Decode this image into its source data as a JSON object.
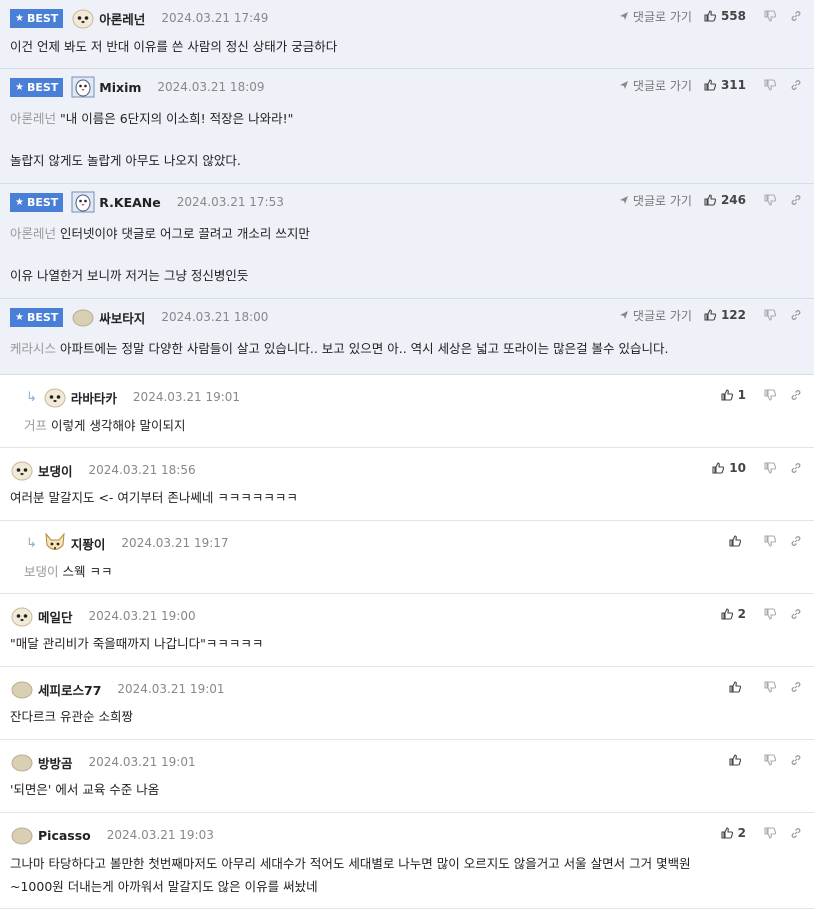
{
  "actions": {
    "goto_label": "댓글로 가기"
  },
  "badge_label": "BEST",
  "comments": [
    {
      "nick": "아론레넌",
      "date": "2024.03.21 17:49",
      "likes": "558",
      "best": true,
      "lines": [
        "이건 언제 봐도 저 반대 이유를 쓴 사람의 정신 상태가 궁금하다"
      ]
    },
    {
      "nick": "Mixim",
      "date": "2024.03.21 18:09",
      "likes": "311",
      "best": true,
      "mention": "아론레넌",
      "lines": [
        "\"내 이름은 6단지의 이소희! 적장은 나와라!\"",
        "",
        "놀랍지 않게도 놀랍게 아무도 나오지 않았다."
      ]
    },
    {
      "nick": "R.KEANe",
      "date": "2024.03.21 17:53",
      "likes": "246",
      "best": true,
      "mention": "아론레넌",
      "lines": [
        "인터넷이야 댓글로 어그로 끌려고 개소리 쓰지만",
        "",
        "이유 나열한거 보니까 저거는 그냥 정신병인듯"
      ]
    },
    {
      "nick": "싸보타지",
      "date": "2024.03.21 18:00",
      "likes": "122",
      "best": true,
      "mention": "케라시스",
      "lines": [
        "아파트에는 정말 다양한 사람들이 살고 있습니다.. 보고 있으면 아.. 역시 세상은 넓고 또라이는 많은걸 볼수 있습니다."
      ]
    },
    {
      "nick": "라바타카",
      "date": "2024.03.21 19:01",
      "likes": "1",
      "reply": true,
      "mention": "거프",
      "lines": [
        "이렇게 생각해야 말이되지"
      ]
    },
    {
      "nick": "보댕이",
      "date": "2024.03.21 18:56",
      "likes": "10",
      "lines": [
        "여러분 말갈지도 <- 여기부터 존나쎄네 ㅋㅋㅋㅋㅋㅋㅋ"
      ]
    },
    {
      "nick": "지퐝이",
      "date": "2024.03.21 19:17",
      "likes": "",
      "reply": true,
      "mention": "보댕이",
      "lines": [
        "스웩 ㅋㅋ"
      ]
    },
    {
      "nick": "메일단",
      "date": "2024.03.21 19:00",
      "likes": "2",
      "lines": [
        "\"매달 관리비가 죽을때까지 나갑니다\"ㅋㅋㅋㅋㅋ"
      ]
    },
    {
      "nick": "세피로스77",
      "date": "2024.03.21 19:01",
      "likes": "",
      "lines": [
        "잔다르크 유관순 소희짱"
      ]
    },
    {
      "nick": "방방곰",
      "date": "2024.03.21 19:01",
      "likes": "",
      "lines": [
        "'되면은' 에서 교육 수준 나옴"
      ]
    },
    {
      "nick": "Picasso",
      "date": "2024.03.21 19:03",
      "likes": "2",
      "lines": [
        "그나마 타당하다고 볼만한 첫번째마저도 아무리 세대수가 적어도 세대별로 나누면 많이 오르지도 않을거고 서울 살면서 그거 몇백원",
        "~1000원 더내는게 아까워서 말갈지도 않은 이유를 써놨네"
      ]
    }
  ],
  "avatars": [
    "puppy-icon",
    "penguin-icon",
    "penguin-icon",
    "blob-icon",
    "puppy-icon",
    "puppy-icon",
    "fox-icon",
    "puppy-icon",
    "blob-icon",
    "blob-icon",
    "blob-icon"
  ]
}
